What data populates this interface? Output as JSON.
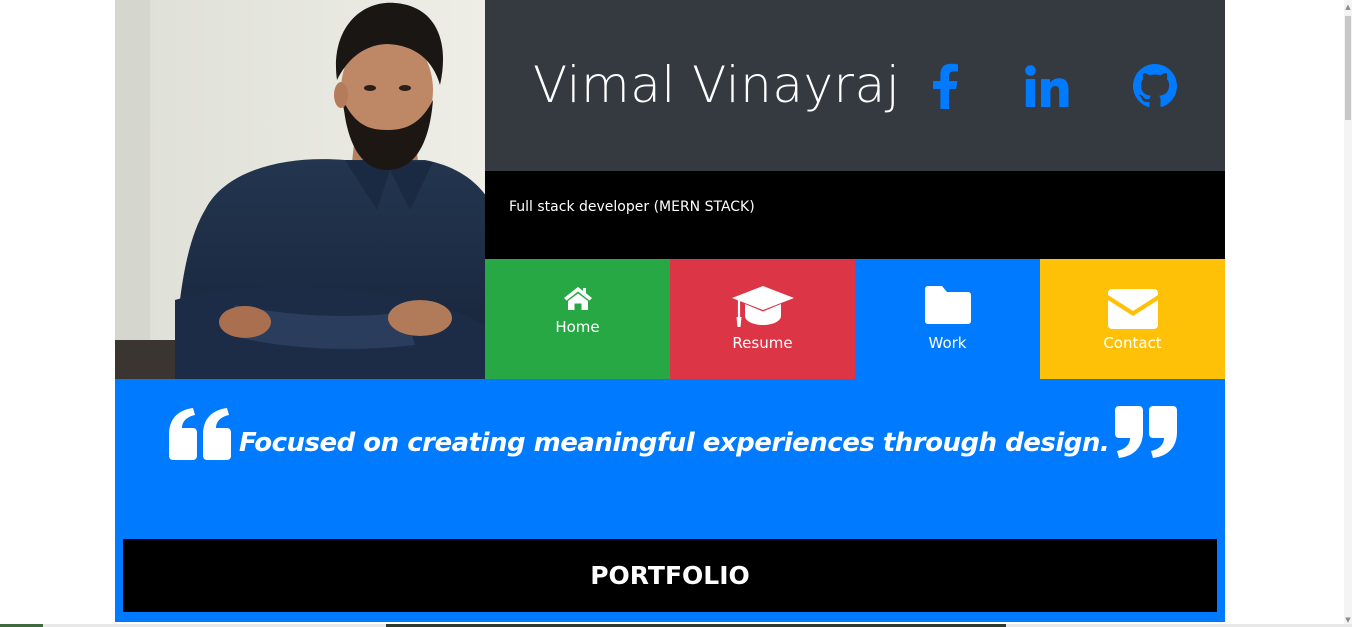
{
  "header": {
    "name": "Vimal Vinayraj",
    "social": [
      {
        "icon": "facebook-icon",
        "color": "#007bff"
      },
      {
        "icon": "linkedin-icon",
        "color": "#007bff"
      },
      {
        "icon": "github-icon",
        "color": "#007bff"
      }
    ],
    "background": "#343a40"
  },
  "subtitle": "Full stack developer (MERN STACK)",
  "nav": [
    {
      "label": "Home",
      "icon": "home-icon",
      "color": "#28a745"
    },
    {
      "label": "Resume",
      "icon": "graduation-cap-icon",
      "color": "#dc3545"
    },
    {
      "label": "Work",
      "icon": "folder-icon",
      "color": "#007bff"
    },
    {
      "label": "Contact",
      "icon": "envelope-icon",
      "color": "#ffc107"
    }
  ],
  "quote": {
    "text": "Focused on creating meaningful experiences through design.",
    "open_icon": "quote-left-icon",
    "close_icon": "quote-right-icon",
    "background": "#007bff"
  },
  "portfolio": {
    "label": "PORTFOLIO"
  },
  "photo": {
    "icon": "profile-photo"
  }
}
